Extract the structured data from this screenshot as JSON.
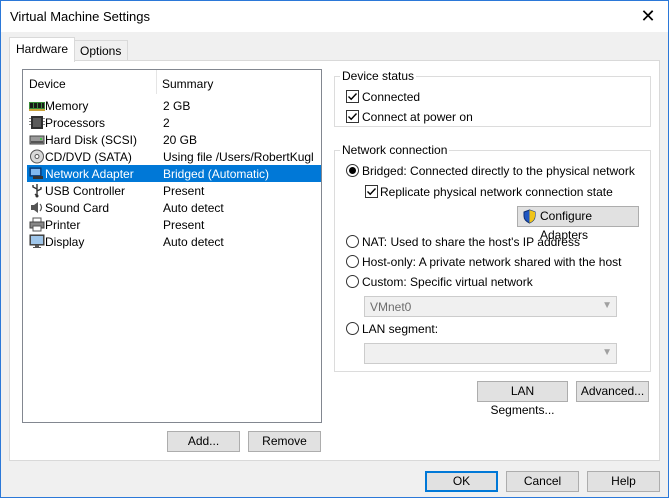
{
  "window": {
    "title": "Virtual Machine Settings",
    "close_glyph": "✕"
  },
  "tabs": [
    {
      "label": "Hardware"
    },
    {
      "label": "Options"
    }
  ],
  "device_list": {
    "headers": {
      "device": "Device",
      "summary": "Summary"
    },
    "rows": [
      {
        "icon": "memory-icon",
        "name": "Memory",
        "summary": "2 GB",
        "selected": false
      },
      {
        "icon": "processor-icon",
        "name": "Processors",
        "summary": "2",
        "selected": false
      },
      {
        "icon": "hard-disk-icon",
        "name": "Hard Disk (SCSI)",
        "summary": "20 GB",
        "selected": false
      },
      {
        "icon": "cd-dvd-icon",
        "name": "CD/DVD (SATA)",
        "summary": "Using file /Users/RobertKugl...",
        "selected": false
      },
      {
        "icon": "network-adapter-icon",
        "name": "Network Adapter",
        "summary": "Bridged (Automatic)",
        "selected": true
      },
      {
        "icon": "usb-icon",
        "name": "USB Controller",
        "summary": "Present",
        "selected": false
      },
      {
        "icon": "sound-card-icon",
        "name": "Sound Card",
        "summary": "Auto detect",
        "selected": false
      },
      {
        "icon": "printer-icon",
        "name": "Printer",
        "summary": "Present",
        "selected": false
      },
      {
        "icon": "display-icon",
        "name": "Display",
        "summary": "Auto detect",
        "selected": false
      }
    ]
  },
  "list_buttons": {
    "add": "Add...",
    "remove": "Remove"
  },
  "device_status": {
    "legend": "Device status",
    "connected": {
      "label": "Connected",
      "checked": true
    },
    "connect_at_power_on": {
      "label": "Connect at power on",
      "checked": true
    }
  },
  "network_connection": {
    "legend": "Network connection",
    "bridged": {
      "label": "Bridged: Connected directly to the physical network",
      "selected": true
    },
    "replicate": {
      "label": "Replicate physical network connection state",
      "checked": true
    },
    "configure_adapters": "Configure Adapters",
    "nat": {
      "label": "NAT: Used to share the host's IP address",
      "selected": false
    },
    "host_only": {
      "label": "Host-only: A private network shared with the host",
      "selected": false
    },
    "custom": {
      "label": "Custom: Specific virtual network",
      "selected": false
    },
    "custom_value": "VMnet0",
    "lan_segment": {
      "label": "LAN segment:",
      "selected": false
    },
    "lan_segment_value": ""
  },
  "network_buttons": {
    "lan_segments": "LAN Segments...",
    "advanced": "Advanced..."
  },
  "footer": {
    "ok": "OK",
    "cancel": "Cancel",
    "help": "Help"
  },
  "colors": {
    "selection": "#0078d7",
    "accent_border": "#0078d7",
    "button_face": "#e1e1e1"
  }
}
